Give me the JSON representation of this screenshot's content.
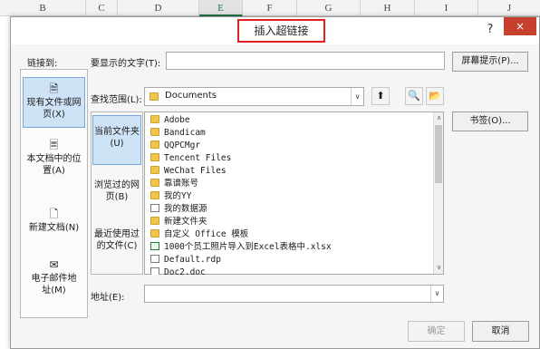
{
  "sheet": {
    "columns": [
      "B",
      "C",
      "D",
      "E",
      "F",
      "G",
      "H",
      "I",
      "J"
    ],
    "active_column": "E"
  },
  "dialog": {
    "title": "插入超链接",
    "help": "?",
    "close": "×"
  },
  "link_to": {
    "label": "链接到:",
    "items": [
      {
        "label": "现有文件或网页(X)",
        "icon": "globe-page-icon",
        "selected": true
      },
      {
        "label": "本文档中的位置(A)",
        "icon": "document-location-icon",
        "selected": false
      },
      {
        "label": "新建文档(N)",
        "icon": "new-document-icon",
        "selected": false
      },
      {
        "label": "电子邮件地址(M)",
        "icon": "email-icon",
        "selected": false
      }
    ]
  },
  "display_text": {
    "label": "要显示的文字(T):",
    "value": ""
  },
  "screentip_button": "屏幕提示(P)...",
  "look_in": {
    "label": "查找范围(L):",
    "value": "Documents"
  },
  "nav": [
    {
      "label": "当前文件夹(U)",
      "selected": true
    },
    {
      "label": "浏览过的网页(B)",
      "selected": false
    },
    {
      "label": "最近使用过的文件(C)",
      "selected": false
    }
  ],
  "files": [
    {
      "name": "Adobe",
      "type": "folder"
    },
    {
      "name": "Bandicam",
      "type": "folder"
    },
    {
      "name": "QQPCMgr",
      "type": "folder"
    },
    {
      "name": "Tencent Files",
      "type": "folder"
    },
    {
      "name": "WeChat Files",
      "type": "folder"
    },
    {
      "name": "靠谱账号",
      "type": "folder"
    },
    {
      "name": "我的YY",
      "type": "folder"
    },
    {
      "name": "我的数据源",
      "type": "datasource"
    },
    {
      "name": "新建文件夹",
      "type": "folder"
    },
    {
      "name": "自定义 Office 模板",
      "type": "folder"
    },
    {
      "name": "1000个员工照片导入到Excel表格中.xlsx",
      "type": "xlsx"
    },
    {
      "name": "Default.rdp",
      "type": "doc"
    },
    {
      "name": "Doc2.doc",
      "type": "doc"
    }
  ],
  "bookmark_button": "书签(O)...",
  "address": {
    "label": "地址(E):",
    "value": ""
  },
  "ok_button": "确定",
  "cancel_button": "取消"
}
